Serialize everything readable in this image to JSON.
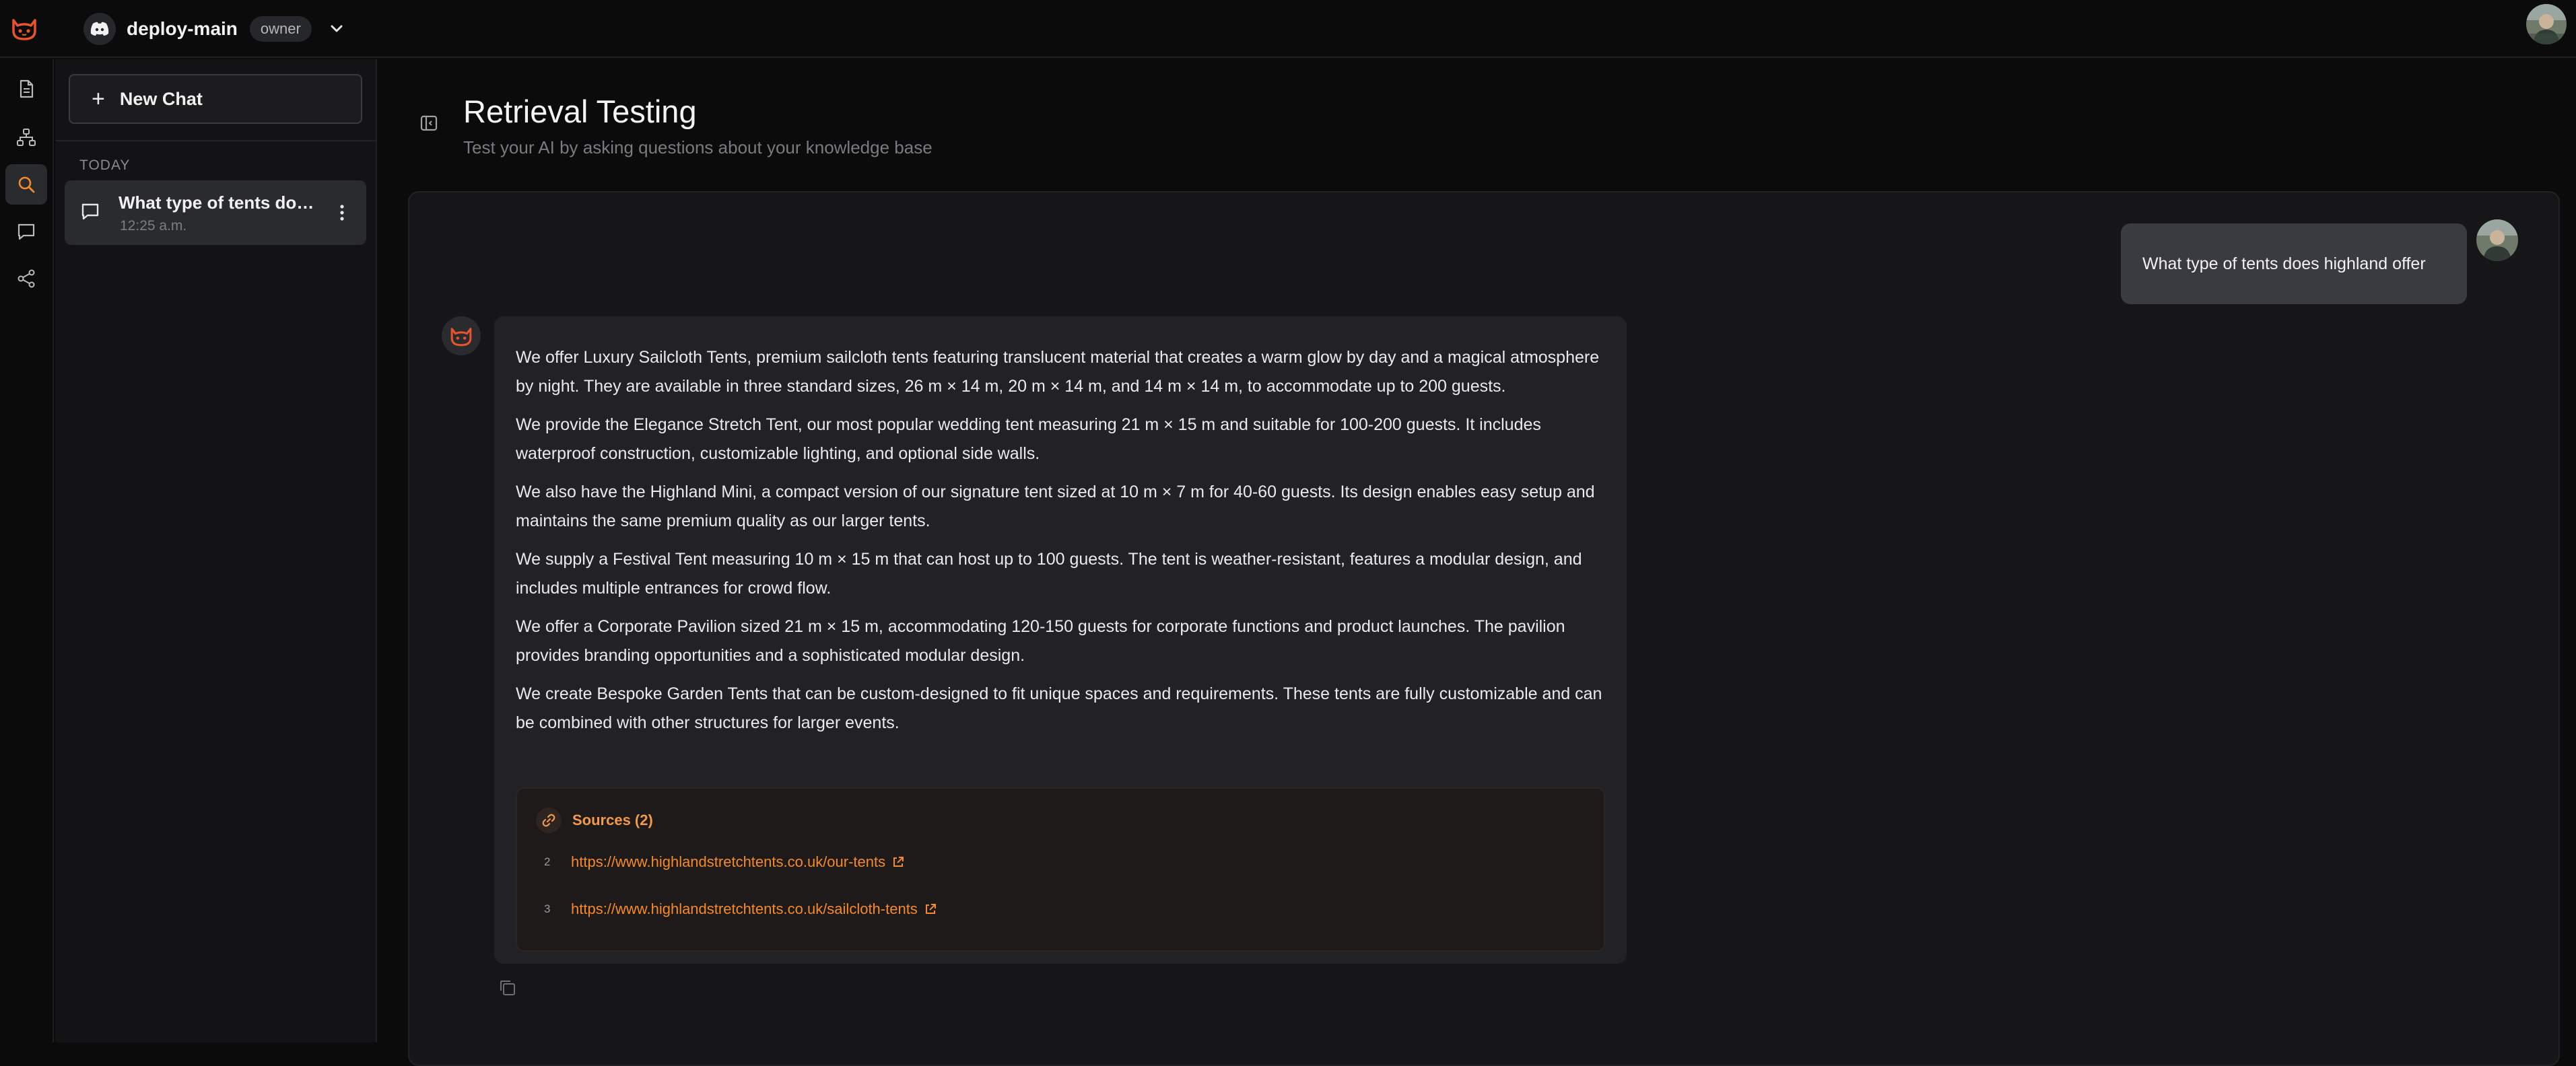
{
  "workspace": {
    "name": "deploy-main",
    "role": "owner"
  },
  "sidebar": {
    "new_chat_label": "New Chat",
    "group_label": "TODAY",
    "chats": [
      {
        "title": "What type of tents doe...",
        "time": "12:25 a.m."
      }
    ]
  },
  "main": {
    "title": "Retrieval Testing",
    "subtitle": "Test your AI by asking questions about your knowledge base"
  },
  "conversation": {
    "user_message": "What type of tents does highland offer",
    "assistant_paragraphs": [
      "We offer Luxury Sailcloth Tents, premium sailcloth tents featuring translucent material that creates a warm glow by day and a magical atmosphere by night. They are available in three standard sizes, 26 m × 14 m, 20 m × 14 m, and 14 m × 14 m, to accommodate up to 200 guests.",
      "We provide the Elegance Stretch Tent, our most popular wedding tent measuring 21 m × 15 m and suitable for 100-200 guests. It includes waterproof construction, customizable lighting, and optional side walls.",
      "We also have the Highland Mini, a compact version of our signature tent sized at 10 m × 7 m for 40-60 guests. Its design enables easy setup and maintains the same premium quality as our larger tents.",
      "We supply a Festival Tent measuring 10 m × 15 m that can host up to 100 guests. The tent is weather-resistant, features a modular design, and includes multiple entrances for crowd flow.",
      "We offer a Corporate Pavilion sized 21 m × 15 m, accommodating 120-150 guests for corporate functions and product launches. The pavilion provides branding opportunities and a sophisticated modular design.",
      "We create Bespoke Garden Tents that can be custom-designed to fit unique spaces and requirements. These tents are fully customizable and can be combined with other structures for larger events."
    ],
    "sources_label": "Sources (2)",
    "sources": [
      {
        "num": "2",
        "url": "https://www.highlandstretchtents.co.uk/our-tents"
      },
      {
        "num": "3",
        "url": "https://www.highlandstretchtents.co.uk/sailcloth-tents"
      }
    ]
  },
  "colors": {
    "accent": "#f58a2a",
    "background": "#0b0b0c",
    "panel": "#161618"
  }
}
